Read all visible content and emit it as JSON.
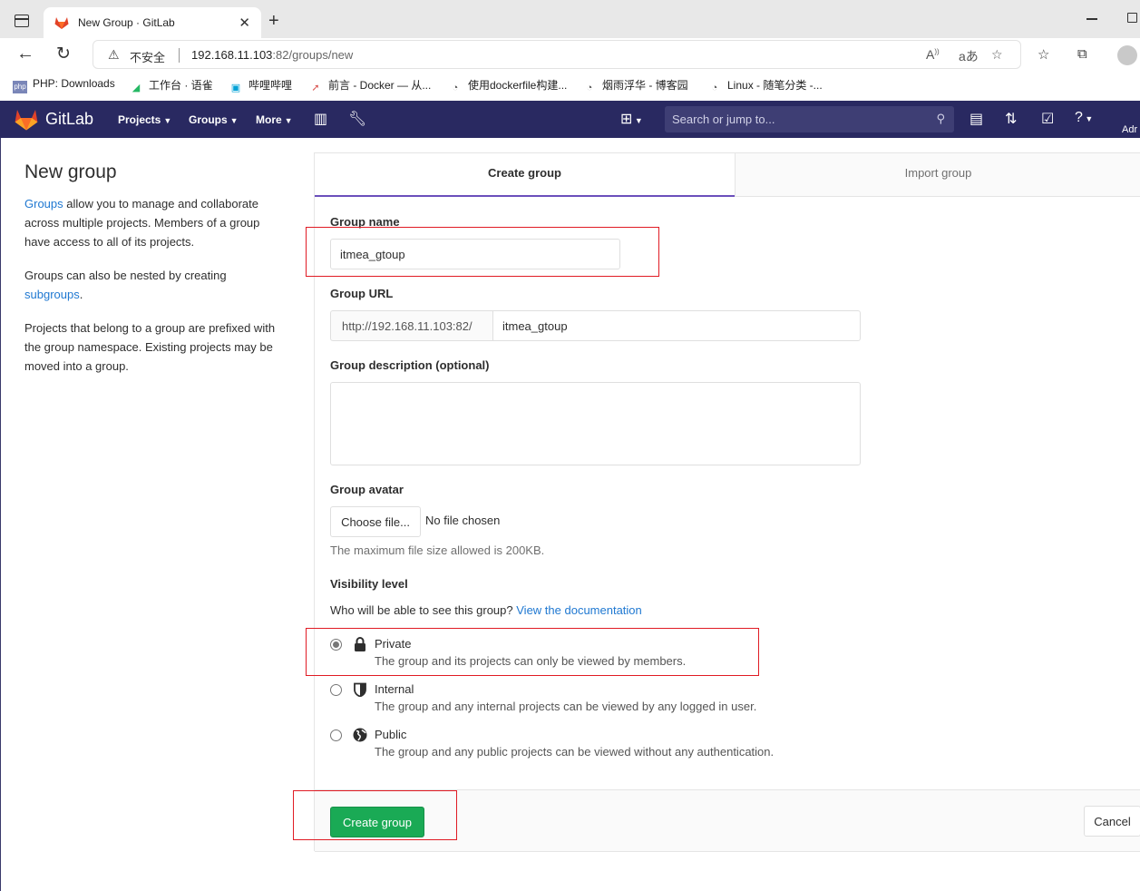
{
  "browser": {
    "tab_title": "New Group · GitLab",
    "insecure_label": "不安全",
    "url_host": "192.168.11.103",
    "url_path": ":82/groups/new"
  },
  "bookmarks": [
    {
      "label": "PHP: Downloads",
      "icon": "php-icon"
    },
    {
      "label": "工作台 · 语雀",
      "icon": "yuque-icon"
    },
    {
      "label": "哔哩哔哩",
      "icon": "bilibili-icon"
    },
    {
      "label": "前言 - Docker — 从...",
      "icon": "rocket-icon"
    },
    {
      "label": "使用dockerfile构建...",
      "icon": "cnblogs-icon"
    },
    {
      "label": "烟雨浮华 - 博客园",
      "icon": "cnblogs-icon"
    },
    {
      "label": "Linux - 随笔分类 -...",
      "icon": "cnblogs-icon"
    }
  ],
  "gitlab_nav": {
    "brand": "GitLab",
    "projects": "Projects",
    "groups": "Groups",
    "more": "More",
    "search_placeholder": "Search or jump to...",
    "avatar_text": "Adr"
  },
  "sidebar": {
    "title": "New group",
    "p1_link": "Groups",
    "p1_text": " allow you to manage and collaborate across multiple projects. Members of a group have access to all of its projects.",
    "p2_text": "Groups can also be nested by creating ",
    "p2_link": "subgroups",
    "p2_end": ".",
    "p3_text": "Projects that belong to a group are prefixed with the group namespace. Existing projects may be moved into a group."
  },
  "tabs": {
    "create": "Create group",
    "import": "Import group"
  },
  "form": {
    "group_name_label": "Group name",
    "group_name_value": "itmea_gtoup",
    "group_url_label": "Group URL",
    "group_url_prefix": "http://192.168.11.103:82/",
    "group_url_value": "itmea_gtoup",
    "description_label": "Group description (optional)",
    "avatar_label": "Group avatar",
    "choose_file": "Choose file...",
    "no_file": "No file chosen",
    "max_size": "The maximum file size allowed is 200KB.",
    "visibility_label": "Visibility level",
    "visibility_question": "Who will be able to see this group?",
    "visibility_doc_link": "View the documentation",
    "options": [
      {
        "title": "Private",
        "desc": "The group and its projects can only be viewed by members.",
        "checked": true,
        "icon": "lock-icon"
      },
      {
        "title": "Internal",
        "desc": "The group and any internal projects can be viewed by any logged in user.",
        "checked": false,
        "icon": "shield-icon"
      },
      {
        "title": "Public",
        "desc": "The group and any public projects can be viewed without any authentication.",
        "checked": false,
        "icon": "globe-icon"
      }
    ],
    "create_button": "Create group",
    "cancel_button": "Cancel"
  },
  "colors": {
    "gitlab_nav": "#292961",
    "primary_green": "#1aaa55",
    "link_blue": "#1f78d1",
    "annotation_red": "#e01b24",
    "active_tab_border": "#6b4fbb"
  }
}
